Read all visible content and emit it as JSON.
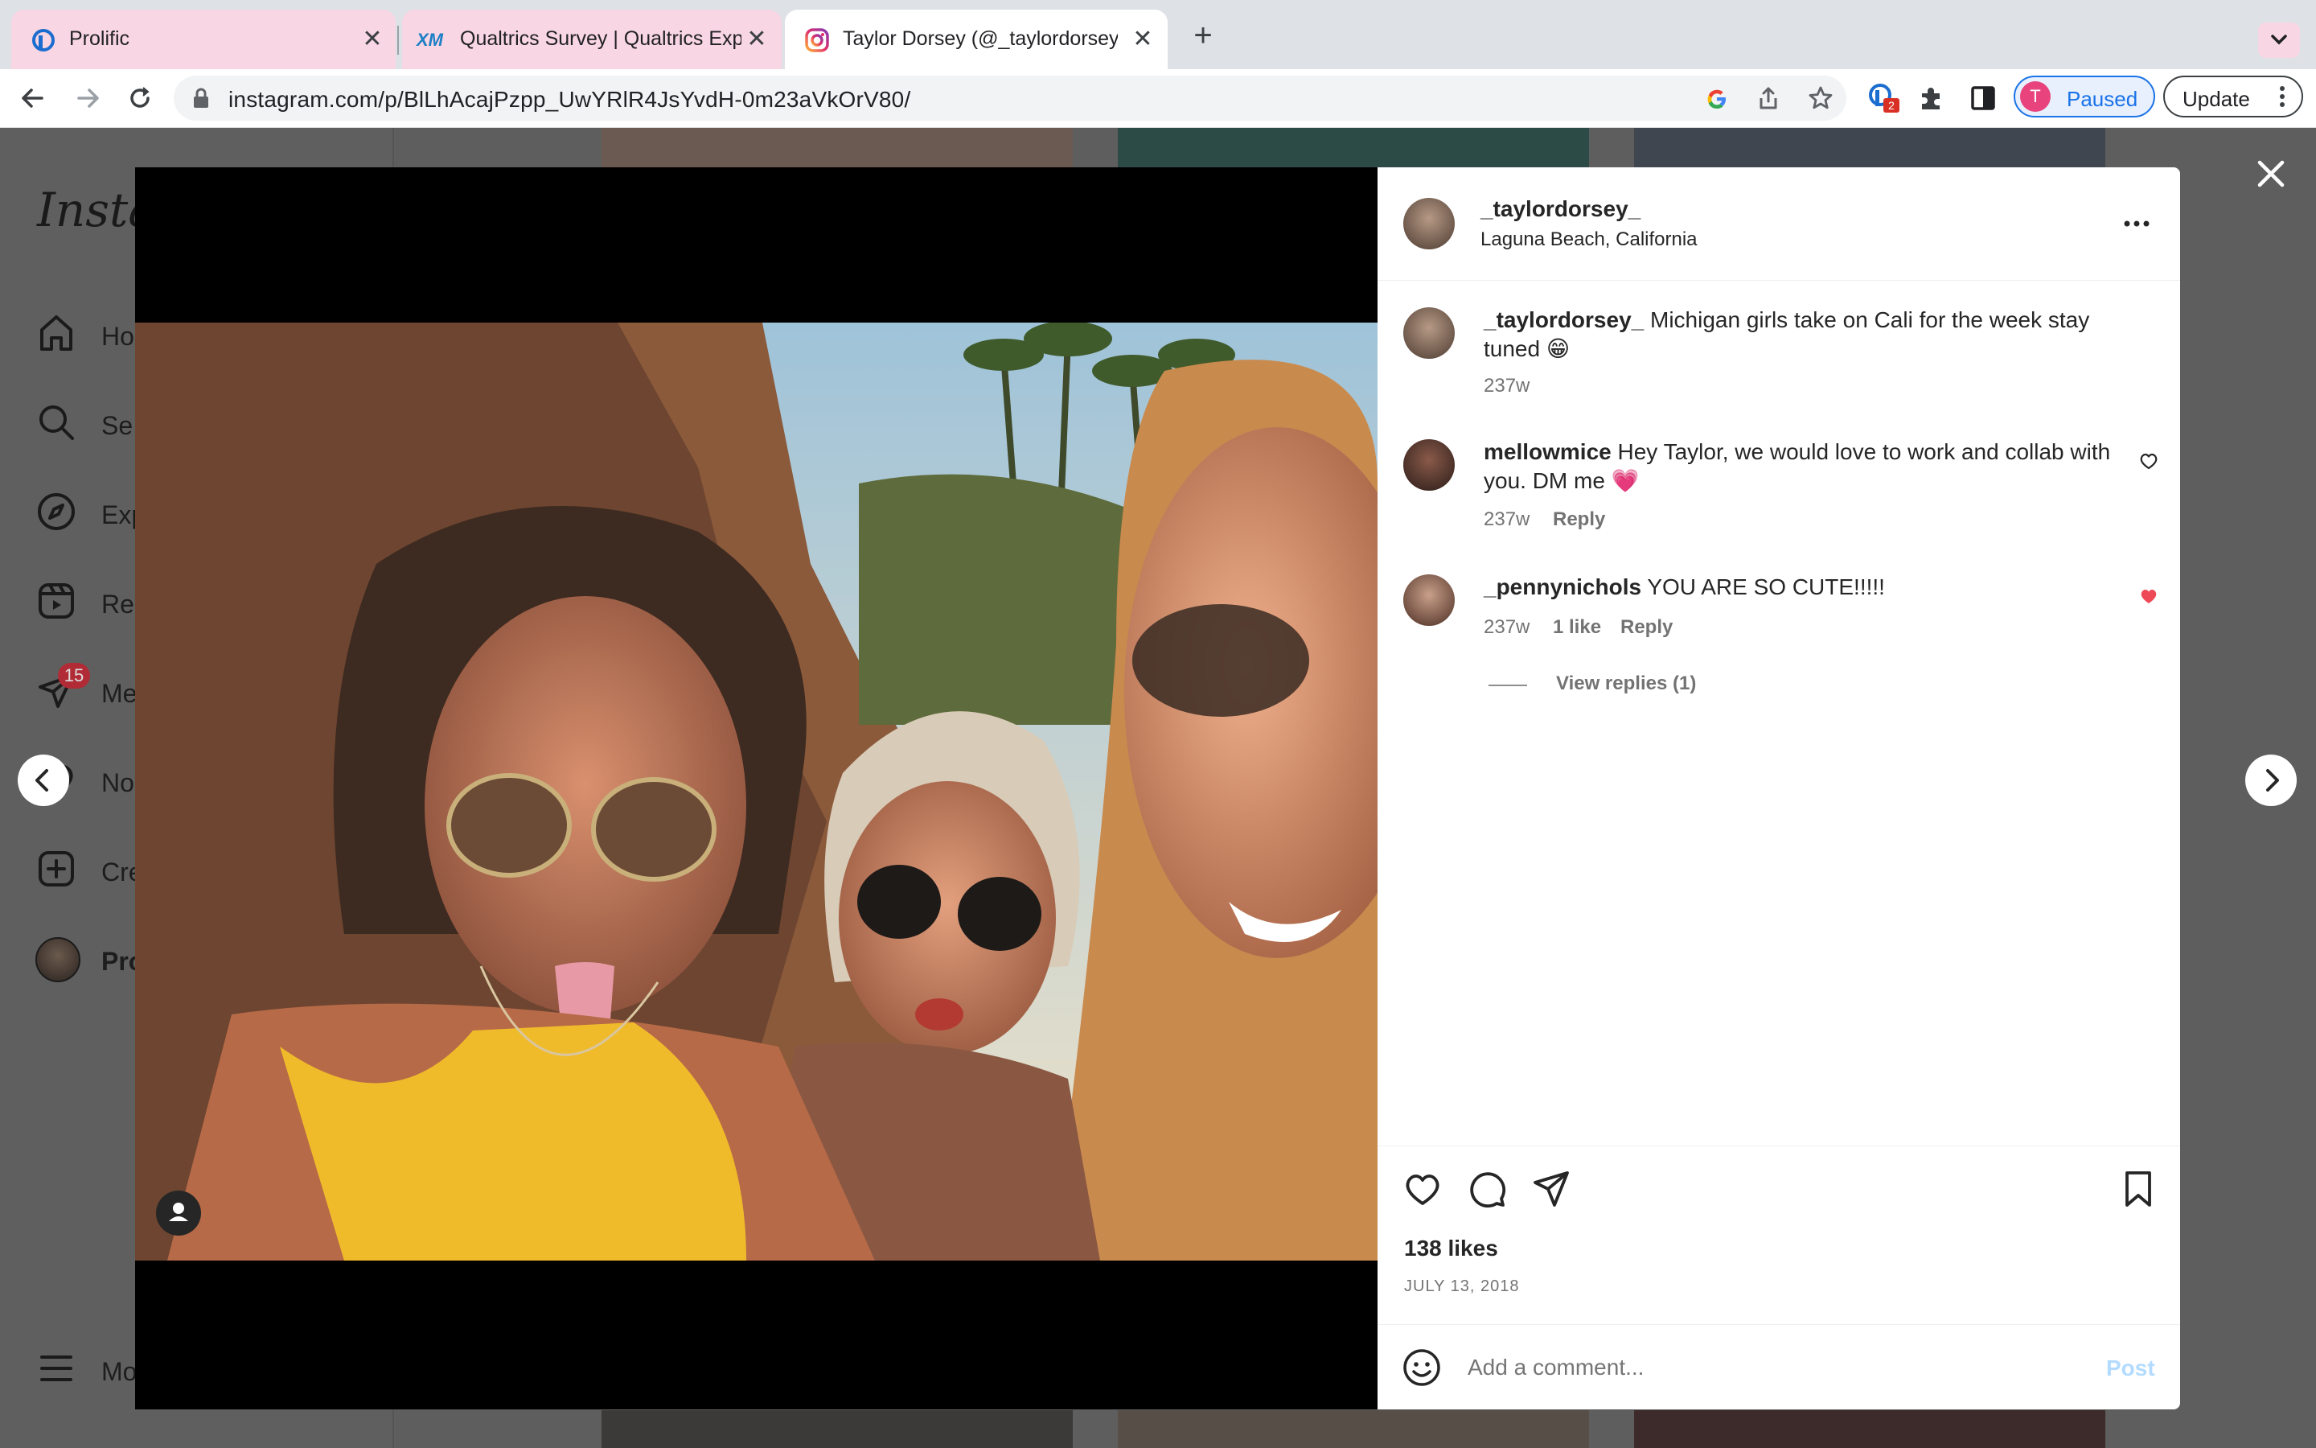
{
  "browser": {
    "tabs": [
      {
        "title": "Prolific",
        "favicon": "prolific-icon"
      },
      {
        "title": "Qualtrics Survey | Qualtrics Exp",
        "favicon": "xm-icon",
        "favicon_text": "XM"
      },
      {
        "title": "Taylor Dorsey (@_taylordorsey",
        "favicon": "instagram-icon"
      }
    ],
    "url": "instagram.com/p/BlLhAcajPzpp_UwYRlR4JsYvdH-0m23aVkOrV80/",
    "profile_initial": "T",
    "profile_status": "Paused",
    "update_label": "Update",
    "extension_badge": "2"
  },
  "instagram": {
    "logo_partial": "Insta",
    "sidebar": [
      {
        "label": "Ho",
        "icon": "home-icon"
      },
      {
        "label": "Se",
        "icon": "search-icon"
      },
      {
        "label": "Exp",
        "icon": "compass-icon"
      },
      {
        "label": "Re",
        "icon": "reels-icon"
      },
      {
        "label": "Me",
        "icon": "messages-icon",
        "badge": "15"
      },
      {
        "label": "No",
        "icon": "heart-icon"
      },
      {
        "label": "Cre",
        "icon": "create-icon"
      },
      {
        "label": "Pro",
        "icon": "profile-avatar"
      },
      {
        "label": "Mo",
        "icon": "menu-icon"
      }
    ]
  },
  "post": {
    "username": "_taylordorsey_",
    "location": "Laguna Beach, California",
    "caption": {
      "username": "_taylordorsey_",
      "text": "Michigan girls take on Cali for the week stay tuned 😁",
      "time": "237w"
    },
    "comments": [
      {
        "username": "mellowmice",
        "text": "Hey Taylor, we would love to work and collab with you. DM me 💗",
        "time": "237w",
        "likes": "",
        "reply_label": "Reply",
        "liked": false
      },
      {
        "username": "_pennynichols",
        "text": "YOU ARE SO CUTE!!!!!",
        "time": "237w",
        "likes": "1 like",
        "reply_label": "Reply",
        "liked": true,
        "view_replies": "View replies (1)"
      }
    ],
    "likes": "138 likes",
    "date": "JULY 13, 2018",
    "comment_placeholder": "Add a comment...",
    "post_label": "Post"
  },
  "colors": {
    "liked": "#ed4956",
    "post_link": "#b3dbff",
    "profile_pink": "#e8437c",
    "tab_active_tint": "#fbd8e6"
  }
}
